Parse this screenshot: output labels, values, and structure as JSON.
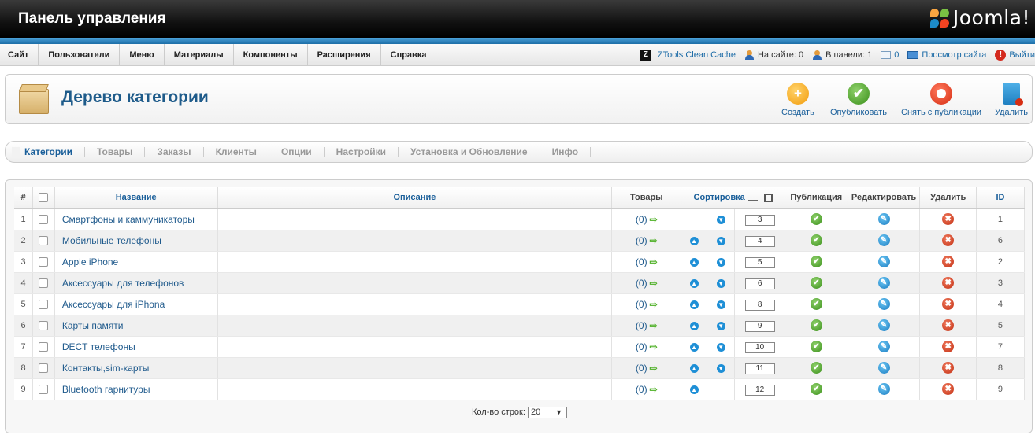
{
  "header": {
    "title": "Панель управления",
    "brand": "Joomla!"
  },
  "menu": [
    "Сайт",
    "Пользователи",
    "Меню",
    "Материалы",
    "Компоненты",
    "Расширения",
    "Справка"
  ],
  "status": {
    "cache": "ZTools Clean Cache",
    "on_site": "На сайте: 0",
    "in_panel": "В панели: 1",
    "messages": "0",
    "view_site": "Просмотр сайта",
    "logout": "Выйти"
  },
  "page": {
    "title": "Дерево категории"
  },
  "toolbar": {
    "create": "Создать",
    "publish": "Опубликовать",
    "unpublish": "Снять с публикации",
    "delete": "Удалить"
  },
  "tabs": [
    "Категории",
    "Товары",
    "Заказы",
    "Клиенты",
    "Опции",
    "Настройки",
    "Установка и Обновление",
    "Инфо"
  ],
  "table": {
    "headers": {
      "num": "#",
      "name": "Название",
      "description": "Описание",
      "products": "Товары",
      "sorting": "Сортировка",
      "publish": "Публикация",
      "edit": "Редактировать",
      "delete": "Удалить",
      "id": "ID"
    },
    "rows": [
      {
        "num": "1",
        "name": "Смартфоны и каммуникаторы",
        "products": "(0)",
        "up": false,
        "down": true,
        "order": "3",
        "id": "1"
      },
      {
        "num": "2",
        "name": "Мобильные телефоны",
        "products": "(0)",
        "up": true,
        "down": true,
        "order": "4",
        "id": "6"
      },
      {
        "num": "3",
        "name": "Apple iPhone",
        "products": "(0)",
        "up": true,
        "down": true,
        "order": "5",
        "id": "2"
      },
      {
        "num": "4",
        "name": "Аксессуары для телефонов",
        "products": "(0)",
        "up": true,
        "down": true,
        "order": "6",
        "id": "3"
      },
      {
        "num": "5",
        "name": "Аксессуары для iPhona",
        "products": "(0)",
        "up": true,
        "down": true,
        "order": "8",
        "id": "4"
      },
      {
        "num": "6",
        "name": "Карты памяти",
        "products": "(0)",
        "up": true,
        "down": true,
        "order": "9",
        "id": "5"
      },
      {
        "num": "7",
        "name": "DECT телефоны",
        "products": "(0)",
        "up": true,
        "down": true,
        "order": "10",
        "id": "7"
      },
      {
        "num": "8",
        "name": "Контакты,sim-карты",
        "products": "(0)",
        "up": true,
        "down": true,
        "order": "11",
        "id": "8"
      },
      {
        "num": "9",
        "name": "Bluetooth гарнитуры",
        "products": "(0)",
        "up": true,
        "down": false,
        "order": "12",
        "id": "9"
      }
    ]
  },
  "footer": {
    "rows_label": "Кол-во строк:",
    "rows_value": "20"
  },
  "icons": {
    "arrow": "⇨",
    "up": "▲",
    "down": "▼",
    "publish": "✔",
    "edit": "✎",
    "delete": "✖",
    "create": "+",
    "publish_tb": "✔"
  },
  "colors": {
    "accent": "#1a5f9a",
    "publish": "#3a8f1a",
    "delete": "#c22f12",
    "edit": "#1a7bc0"
  }
}
